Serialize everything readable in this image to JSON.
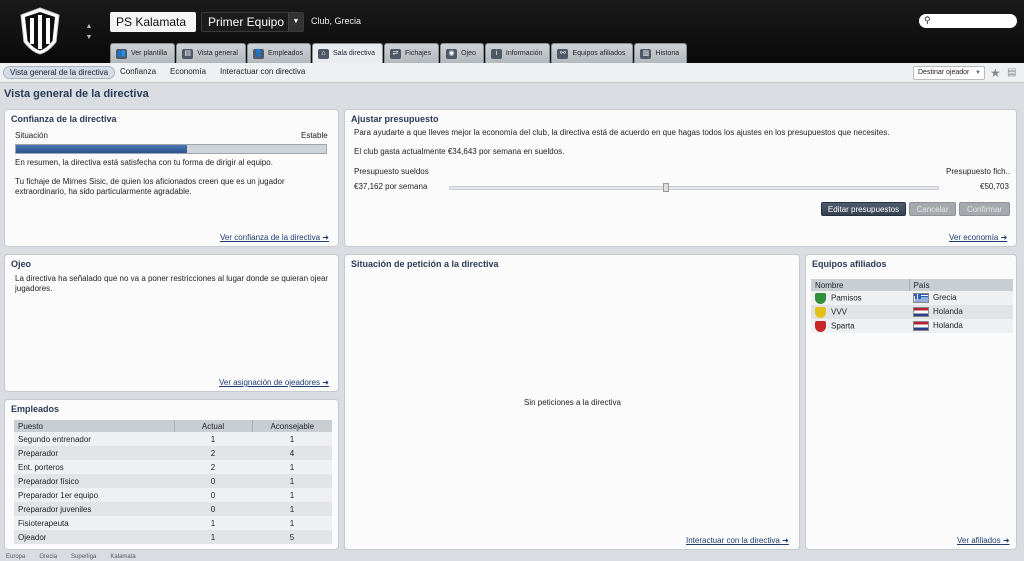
{
  "header": {
    "club_name": "PS Kalamata",
    "team_select": "Primer Equipo",
    "club_info": "Club, Grecia"
  },
  "tabs": [
    {
      "label": "Ver plantilla",
      "icon": "players-icon"
    },
    {
      "label": "Vista general",
      "icon": "overview-icon"
    },
    {
      "label": "Empleados",
      "icon": "staff-icon"
    },
    {
      "label": "Sala directiva",
      "icon": "boardroom-icon",
      "active": true
    },
    {
      "label": "Fichajes",
      "icon": "transfers-icon"
    },
    {
      "label": "Ojeo",
      "icon": "scouting-icon"
    },
    {
      "label": "Información",
      "icon": "info-icon"
    },
    {
      "label": "Equipos afiliados",
      "icon": "affiliates-icon"
    },
    {
      "label": "Historia",
      "icon": "history-icon"
    }
  ],
  "subnav": {
    "items": [
      "Vista general de la directiva",
      "Confianza",
      "Economía",
      "Interactuar con directiva"
    ],
    "scout_select": "Destinar ojeador"
  },
  "page_title": "Vista general de la directiva",
  "confidence": {
    "title": "Confianza de la directiva",
    "situation_label": "Situación",
    "situation_value": "Estable",
    "bar_level": 0.55,
    "summary": "En resumen, la directiva está satisfecha con tu forma de dirigir al equipo.",
    "detail": "Tu fichaje de Mirnes Sisic, de quien los aficionados creen que es un jugador extraordinario, ha sido particularmente agradable.",
    "link": "Ver confianza de la directiva"
  },
  "budget": {
    "title": "Ajustar presupuesto",
    "intro": "Para ayudarte a que lleves mejor la economía del club, la directiva está de acuerdo en que hagas todos los ajustes en los presupuestos que necesites.",
    "spend": "El club gasta actualmente €34,643 por semana en sueldos.",
    "wage_label": "Presupuesto sueldos",
    "transfer_label": "Presupuesto fich..",
    "wage_value": "€37,162 por semana",
    "transfer_value": "€50,703",
    "btn_edit": "Editar presupuestos",
    "btn_cancel": "Cancelar",
    "btn_confirm": "Confirmar",
    "link": "Ver economía"
  },
  "scouting": {
    "title": "Ojeo",
    "text": "La directiva ha señalado que no va a poner restricciones al lugar donde se quieran ojear jugadores.",
    "link": "Ver asignación de ojeadores"
  },
  "requests": {
    "title": "Situación de petición a la directiva",
    "empty": "Sin peticiones a la directiva",
    "link": "Interactuar con la directiva"
  },
  "affiliates": {
    "title": "Equipos afiliados",
    "headers": [
      "Nombre",
      "País"
    ],
    "rows": [
      {
        "name": "Pamisos",
        "country": "Grecia",
        "flag": "greece-flag-icon",
        "badge_color": "#2f8f3a"
      },
      {
        "name": "VVV",
        "country": "Holanda",
        "flag": "netherlands-flag-icon",
        "badge_color": "#e2c21a"
      },
      {
        "name": "Sparta",
        "country": "Holanda",
        "flag": "netherlands-flag-icon",
        "badge_color": "#c62828"
      }
    ],
    "link": "Ver afiliados"
  },
  "staff": {
    "title": "Empleados",
    "headers": [
      "Puesto",
      "Actual",
      "Aconsejable"
    ],
    "rows": [
      [
        "Segundo entrenador",
        "1",
        "1"
      ],
      [
        "Preparador",
        "2",
        "4"
      ],
      [
        "Ent. porteros",
        "2",
        "1"
      ],
      [
        "Preparador físico",
        "0",
        "1"
      ],
      [
        "Preparador 1er equipo",
        "0",
        "1"
      ],
      [
        "Preparador juveniles",
        "0",
        "1"
      ],
      [
        "Fisioterapeuta",
        "1",
        "1"
      ],
      [
        "Ojeador",
        "1",
        "5"
      ]
    ]
  },
  "breadcrumb": [
    "Europa",
    "Grecia",
    "Superliga",
    "Kalamata"
  ]
}
